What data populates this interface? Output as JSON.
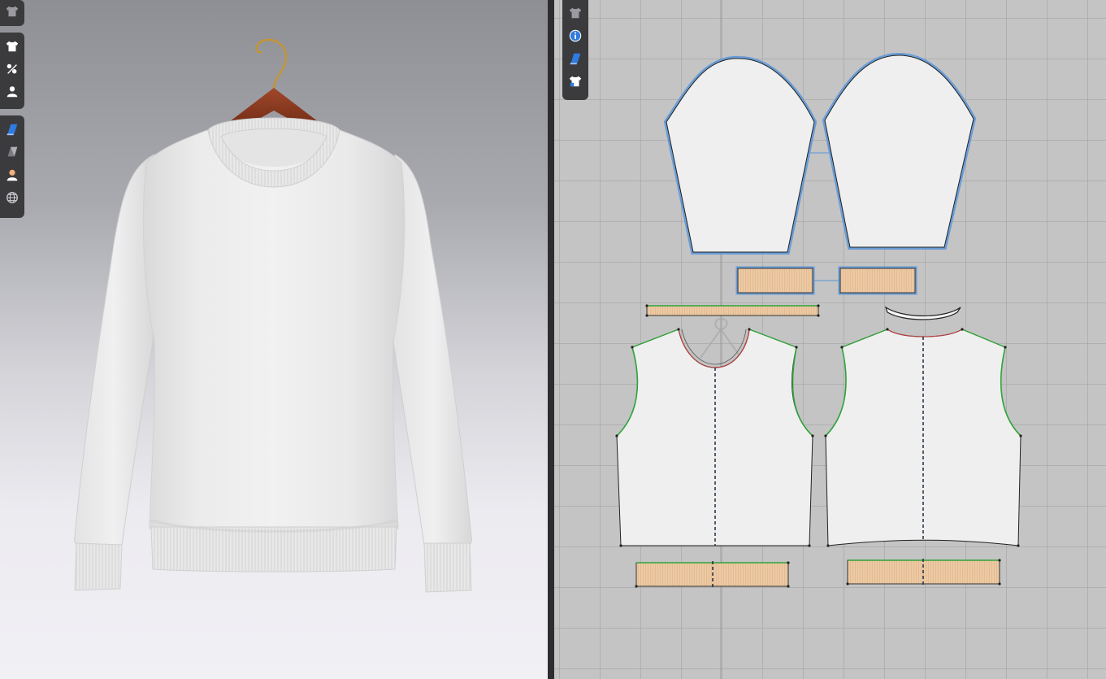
{
  "app": {
    "panes": [
      "3d-garment-view",
      "2d-pattern-view"
    ]
  },
  "toolbar_3d": {
    "groups": [
      [
        "garment-display-icon"
      ],
      [
        "shirt-icon",
        "needle-thread-icon",
        "avatar-icon"
      ],
      [
        "texture-surface-icon",
        "shaded-surface-icon",
        "skin-icon",
        "globe-icon"
      ]
    ]
  },
  "toolbar_2d": {
    "items": [
      "garment-display-icon",
      "info-icon",
      "texture-surface-icon",
      "shirt-lock-icon"
    ]
  },
  "colors": {
    "accent_blue": "#3f7fd6",
    "seam_green": "#2fa43a",
    "rib_fill": "#edc9a3",
    "fabric_white": "#f0f0f0",
    "grid": "#c4c4c4"
  },
  "patterns": [
    {
      "name": "sleeve-left",
      "kind": "sleeve",
      "selected": true
    },
    {
      "name": "sleeve-right",
      "kind": "sleeve",
      "selected": true
    },
    {
      "name": "cuff-left",
      "kind": "rib",
      "selected": true
    },
    {
      "name": "cuff-right",
      "kind": "rib",
      "selected": true
    },
    {
      "name": "neckband",
      "kind": "rib",
      "selected": false
    },
    {
      "name": "front-body",
      "kind": "body",
      "selected": false
    },
    {
      "name": "back-body",
      "kind": "body",
      "selected": false
    },
    {
      "name": "hem-band-front",
      "kind": "rib",
      "selected": false
    },
    {
      "name": "hem-band-back",
      "kind": "rib",
      "selected": false
    }
  ]
}
